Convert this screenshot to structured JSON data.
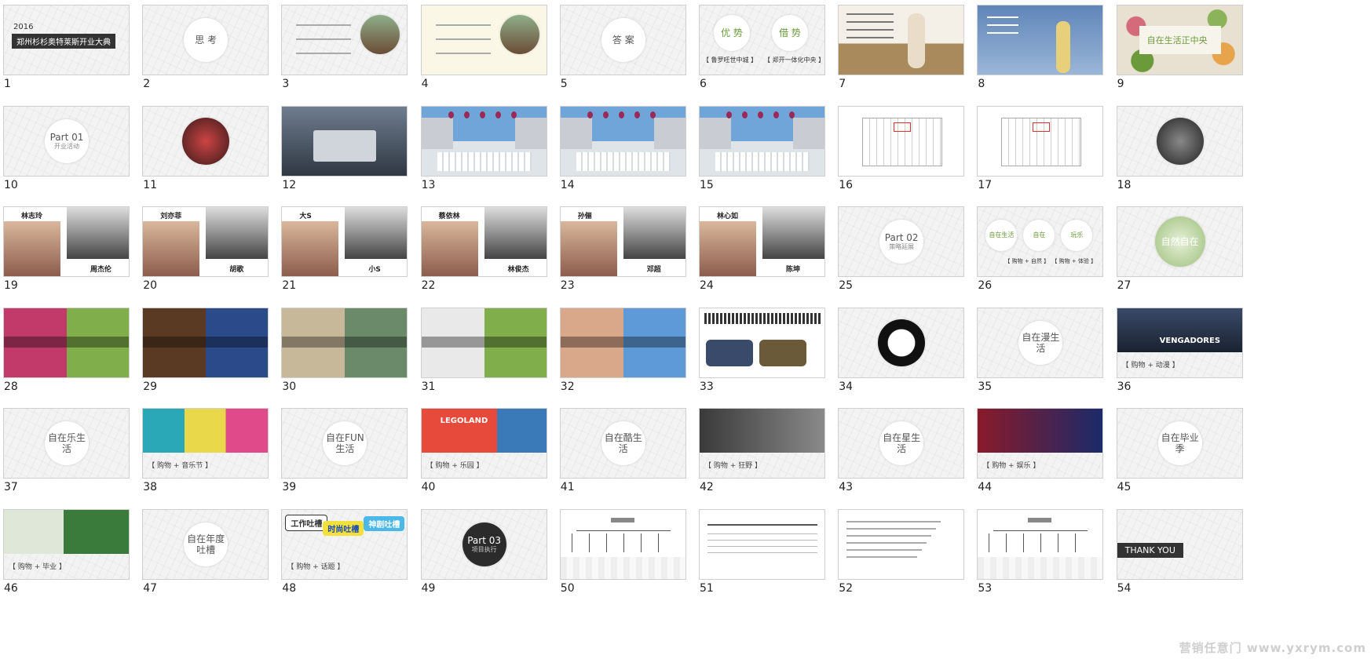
{
  "slides": [
    {
      "n": "1",
      "style": "cover",
      "texts": [
        "2016",
        "郑州杉杉奥特莱斯开业大典"
      ]
    },
    {
      "n": "2",
      "style": "circle",
      "texts": [
        "思 考"
      ]
    },
    {
      "n": "3",
      "style": "bubble-photo",
      "texts": []
    },
    {
      "n": "4",
      "style": "bubble-photo-y",
      "texts": []
    },
    {
      "n": "5",
      "style": "circle",
      "texts": [
        "答 案"
      ]
    },
    {
      "n": "6",
      "style": "two-circles",
      "texts": [
        "优 势",
        "借 势",
        "【 鲁罗旺世中城 】",
        "【 郑开一体化中央 】"
      ]
    },
    {
      "n": "7",
      "style": "photo-girl",
      "texts": []
    },
    {
      "n": "8",
      "style": "photo-blue",
      "texts": []
    },
    {
      "n": "9",
      "style": "flowers",
      "texts": [
        "自在生活正中央"
      ]
    },
    {
      "n": "10",
      "style": "circle",
      "texts": [
        "Part 01",
        "开业活动"
      ]
    },
    {
      "n": "11",
      "style": "circle-photo",
      "texts": []
    },
    {
      "n": "12",
      "style": "render-dark",
      "texts": []
    },
    {
      "n": "13",
      "style": "render-sky",
      "texts": []
    },
    {
      "n": "14",
      "style": "render-sky",
      "texts": []
    },
    {
      "n": "15",
      "style": "render-sky",
      "texts": []
    },
    {
      "n": "16",
      "style": "plan",
      "texts": []
    },
    {
      "n": "17",
      "style": "plan2",
      "texts": []
    },
    {
      "n": "18",
      "style": "circle-photo-bw",
      "texts": []
    },
    {
      "n": "19",
      "style": "duo",
      "texts": [
        "林志玲",
        "周杰伦"
      ]
    },
    {
      "n": "20",
      "style": "duo",
      "texts": [
        "刘亦菲",
        "胡歌"
      ]
    },
    {
      "n": "21",
      "style": "duo",
      "texts": [
        "大S",
        "小S"
      ]
    },
    {
      "n": "22",
      "style": "duo",
      "texts": [
        "蔡依林",
        "林俊杰"
      ]
    },
    {
      "n": "23",
      "style": "duo",
      "texts": [
        "孙俪",
        "邓超"
      ]
    },
    {
      "n": "24",
      "style": "duo",
      "texts": [
        "林心如",
        "陈坤"
      ]
    },
    {
      "n": "25",
      "style": "circle",
      "texts": [
        "Part 02",
        "策略延展"
      ]
    },
    {
      "n": "26",
      "style": "three-circles",
      "texts": [
        "自在生活",
        "自在",
        "玩乐",
        "【 购物 + 自然 】",
        "【 购物 + 体验 】"
      ]
    },
    {
      "n": "27",
      "style": "circle-green",
      "texts": [
        "自然自在"
      ]
    },
    {
      "n": "28",
      "style": "photo-pair",
      "texts": []
    },
    {
      "n": "29",
      "style": "photo-pair2",
      "texts": []
    },
    {
      "n": "30",
      "style": "photo-pair3",
      "texts": []
    },
    {
      "n": "31",
      "style": "photo-pair4",
      "texts": []
    },
    {
      "n": "32",
      "style": "photo-pair5",
      "texts": []
    },
    {
      "n": "33",
      "style": "cards",
      "texts": []
    },
    {
      "n": "34",
      "style": "circle-dance",
      "texts": []
    },
    {
      "n": "35",
      "style": "circle",
      "texts": [
        "自在漫生活"
      ]
    },
    {
      "n": "36",
      "style": "movie",
      "texts": [
        "VENGADORES",
        "【 购物 + 动漫 】"
      ]
    },
    {
      "n": "37",
      "style": "circle",
      "texts": [
        "自在乐生活"
      ]
    },
    {
      "n": "38",
      "style": "poster",
      "texts": [
        "【 购物 + 音乐节 】"
      ]
    },
    {
      "n": "39",
      "style": "circle",
      "texts": [
        "自在FUN生活"
      ]
    },
    {
      "n": "40",
      "style": "lego",
      "texts": [
        "LEGOLAND",
        "【 购物 + 乐园 】"
      ]
    },
    {
      "n": "41",
      "style": "circle",
      "texts": [
        "自在酷生活"
      ]
    },
    {
      "n": "42",
      "style": "film",
      "texts": [
        "【 购物 + 狂野 】"
      ]
    },
    {
      "n": "43",
      "style": "circle",
      "texts": [
        "自在星生活"
      ]
    },
    {
      "n": "44",
      "style": "stage",
      "texts": [
        "【 购物 + 娱乐 】"
      ]
    },
    {
      "n": "45",
      "style": "circle",
      "texts": [
        "自在毕业季"
      ]
    },
    {
      "n": "46",
      "style": "grad",
      "texts": [
        "【 购物 + 毕业 】"
      ]
    },
    {
      "n": "47",
      "style": "circle",
      "texts": [
        "自在年度吐槽"
      ]
    },
    {
      "n": "48",
      "style": "bubbles",
      "texts": [
        "工作吐槽",
        "时尚吐槽",
        "神剧吐槽",
        "【 购物 + 话题 】"
      ]
    },
    {
      "n": "49",
      "style": "circle-dark",
      "texts": [
        "Part 03",
        "项目执行"
      ]
    },
    {
      "n": "50",
      "style": "org",
      "texts": []
    },
    {
      "n": "51",
      "style": "table",
      "texts": []
    },
    {
      "n": "52",
      "style": "doc",
      "texts": []
    },
    {
      "n": "53",
      "style": "org",
      "texts": []
    },
    {
      "n": "54",
      "style": "thanks",
      "texts": [
        "THANK YOU"
      ]
    }
  ],
  "watermark": "营销任意门 www.yxrym.com"
}
